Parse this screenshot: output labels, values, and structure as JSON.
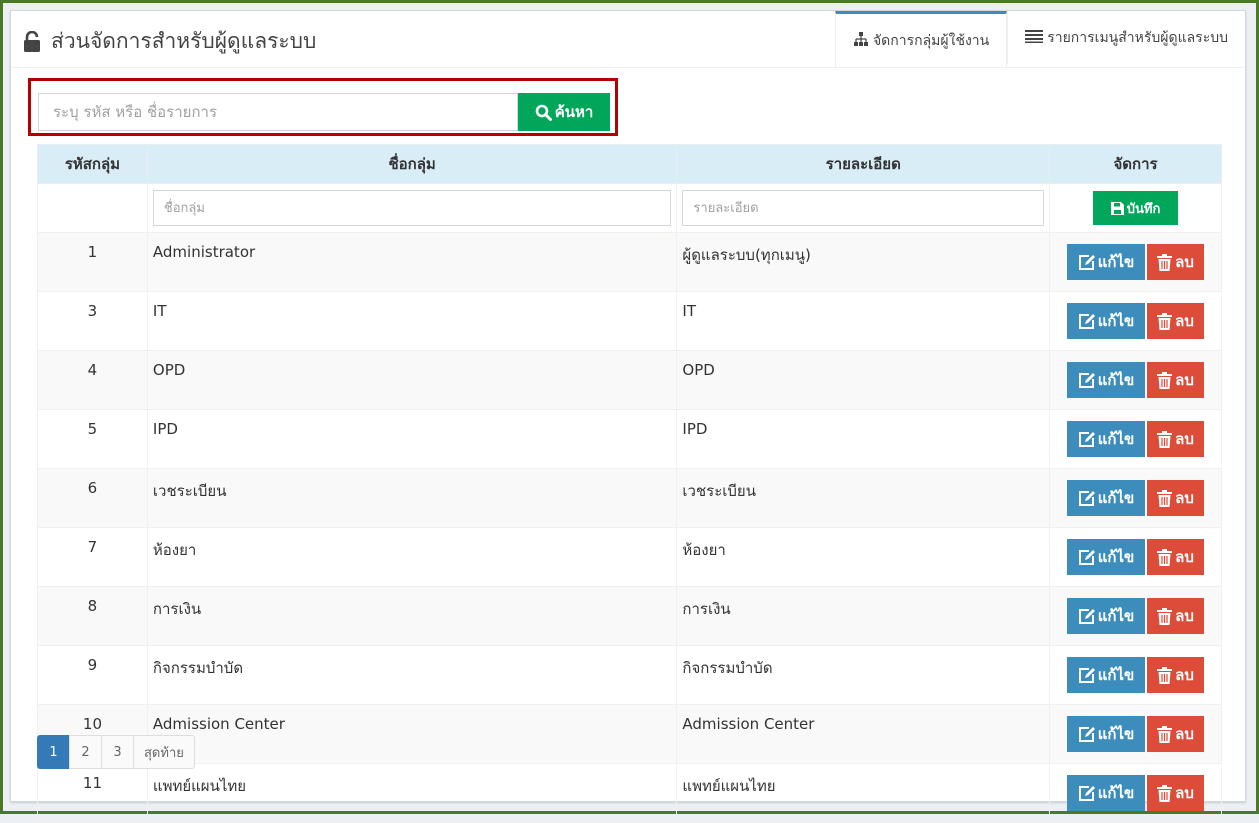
{
  "header": {
    "title": "ส่วนจัดการสำหรับผู้ดูแลระบบ",
    "tabs": [
      {
        "label": "จัดการกลุ่มผู้ใช้งาน",
        "icon": "sitemap-icon",
        "active": true
      },
      {
        "label": "รายการเมนูสำหรับผู้ดูแลระบบ",
        "icon": "list-icon",
        "active": false
      }
    ]
  },
  "search": {
    "placeholder": "ระบุ รหัส หรือ ชื่อรายการ",
    "button_label": "ค้นหา"
  },
  "table": {
    "headers": [
      "รหัสกลุ่ม",
      "ชื่อกลุ่ม",
      "รายละเอียด",
      "จัดการ"
    ],
    "new_row": {
      "name_placeholder": "ชื่อกลุ่ม",
      "detail_placeholder": "รายละเอียด",
      "save_label": "บันทึก"
    },
    "edit_label": "แก้ไข",
    "delete_label": "ลบ",
    "rows": [
      {
        "id": "1",
        "name": "Administrator",
        "detail": "ผู้ดูแลระบบ(ทุกเมนู)"
      },
      {
        "id": "3",
        "name": "IT",
        "detail": "IT"
      },
      {
        "id": "4",
        "name": "OPD",
        "detail": "OPD"
      },
      {
        "id": "5",
        "name": "IPD",
        "detail": "IPD"
      },
      {
        "id": "6",
        "name": "เวชระเบียน",
        "detail": "เวชระเบียน"
      },
      {
        "id": "7",
        "name": "ห้องยา",
        "detail": "ห้องยา"
      },
      {
        "id": "8",
        "name": "การเงิน",
        "detail": "การเงิน"
      },
      {
        "id": "9",
        "name": "กิจกรรมบำบัด",
        "detail": "กิจกรรมบำบัด"
      },
      {
        "id": "10",
        "name": "Admission Center",
        "detail": "Admission Center"
      },
      {
        "id": "11",
        "name": "แพทย์แผนไทย",
        "detail": "แพทย์แผนไทย"
      }
    ]
  },
  "pagination": {
    "pages": [
      "1",
      "2",
      "3"
    ],
    "active_page": "1",
    "last_label": "สุดท้าย"
  },
  "colors": {
    "accent": "#3c8dbc",
    "success": "#00a65a",
    "danger": "#dd4b39",
    "highlight_border": "#b40000"
  }
}
